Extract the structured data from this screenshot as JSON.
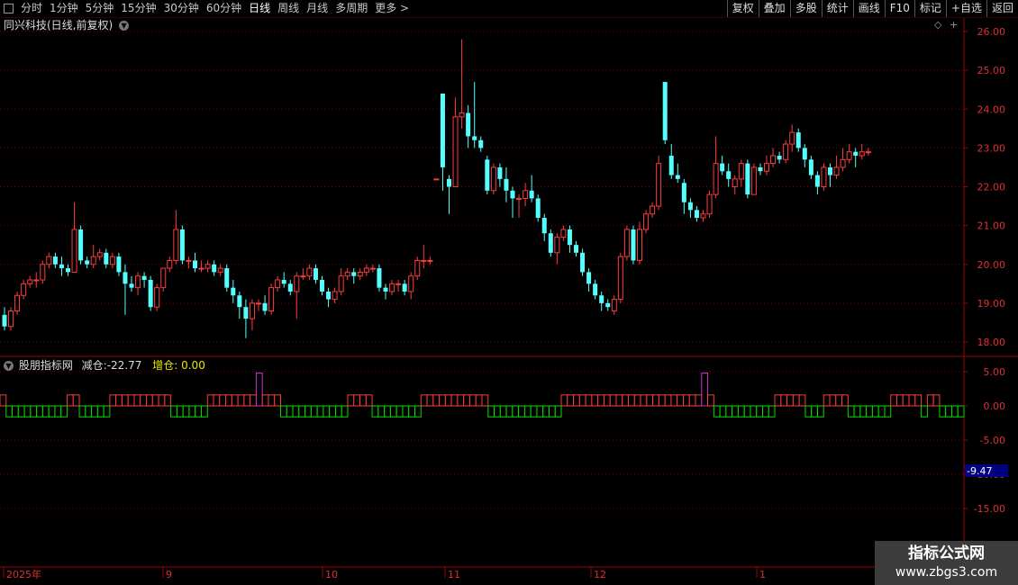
{
  "toolbar": {
    "periods": [
      "分时",
      "1分钟",
      "5分钟",
      "15分钟",
      "30分钟",
      "60分钟",
      "日线",
      "周线",
      "月线",
      "多周期",
      "更多 >"
    ],
    "active_period": "日线",
    "buttons": [
      "复权",
      "叠加",
      "多股",
      "统计",
      "画线",
      "F10",
      "标记",
      "+自选",
      "返回"
    ]
  },
  "panel": {
    "title": "同兴科技(日线,前复权)",
    "price_axis": [
      "26.00",
      "25.00",
      "24.00",
      "23.00",
      "22.00",
      "21.00",
      "20.00",
      "19.00",
      "18.00"
    ]
  },
  "indicator": {
    "name": "股朋指标网",
    "reduce_label": "减仓:",
    "reduce_value": "-22.77",
    "add_label": "增仓:",
    "add_value": "0.00",
    "axis": [
      "5.00",
      "0.00",
      "-5.00",
      "-10.00",
      "-15.00"
    ],
    "current_value": "-9.47"
  },
  "date_axis": [
    "2025年",
    "9",
    "10",
    "11",
    "12",
    "1"
  ],
  "watermark": {
    "line1": "指标公式网",
    "line2": "www.zbgs3.com"
  },
  "colors": {
    "up": "#ff3c3c",
    "down": "#54ffff",
    "bg": "#000000",
    "grid": "#7a0000",
    "neg": "#00e000",
    "special": "#cc33cc"
  },
  "chart_data": {
    "type": "candlestick",
    "ylim": [
      17.8,
      26.2
    ],
    "candles": [
      [
        18.7,
        18.4,
        18.9,
        18.3
      ],
      [
        18.4,
        18.8,
        18.9,
        18.3
      ],
      [
        18.8,
        19.2,
        19.3,
        18.7
      ],
      [
        19.2,
        19.5,
        19.6,
        19.1
      ],
      [
        19.5,
        19.6,
        19.7,
        19.4
      ],
      [
        19.6,
        19.6,
        19.8,
        19.4
      ],
      [
        19.6,
        20.0,
        20.1,
        19.5
      ],
      [
        20.0,
        20.2,
        20.3,
        19.9
      ],
      [
        20.2,
        20.0,
        20.3,
        19.9
      ],
      [
        20.0,
        19.9,
        20.2,
        19.7
      ],
      [
        19.9,
        19.8,
        20.0,
        19.7
      ],
      [
        19.8,
        20.9,
        21.6,
        19.8
      ],
      [
        20.9,
        20.1,
        21.0,
        20.0
      ],
      [
        20.1,
        20.0,
        20.2,
        19.9
      ],
      [
        20.0,
        20.2,
        20.5,
        19.9
      ],
      [
        20.2,
        20.3,
        20.4,
        20.1
      ],
      [
        20.3,
        20.0,
        20.4,
        19.9
      ],
      [
        20.0,
        20.2,
        20.3,
        19.9
      ],
      [
        20.2,
        19.8,
        20.3,
        19.7
      ],
      [
        19.8,
        19.5,
        20.0,
        18.7
      ],
      [
        19.5,
        19.4,
        19.7,
        19.3
      ],
      [
        19.4,
        19.7,
        19.8,
        19.2
      ],
      [
        19.7,
        19.6,
        19.8,
        19.4
      ],
      [
        19.6,
        18.9,
        19.7,
        18.8
      ],
      [
        18.9,
        19.4,
        19.5,
        18.8
      ],
      [
        19.4,
        19.9,
        19.9,
        19.3
      ],
      [
        19.9,
        20.1,
        20.2,
        19.8
      ],
      [
        20.1,
        20.9,
        21.4,
        20.0
      ],
      [
        20.9,
        20.1,
        21.0,
        20.0
      ],
      [
        20.1,
        20.1,
        20.2,
        19.9
      ],
      [
        20.1,
        19.9,
        20.3,
        19.8
      ],
      [
        19.9,
        19.9,
        20.1,
        19.8
      ],
      [
        19.9,
        20.0,
        20.1,
        19.8
      ],
      [
        20.0,
        19.8,
        20.1,
        19.7
      ],
      [
        19.8,
        19.9,
        20.0,
        19.7
      ],
      [
        19.9,
        19.4,
        20.0,
        19.3
      ],
      [
        19.4,
        19.2,
        19.6,
        19.0
      ],
      [
        19.2,
        18.9,
        19.3,
        18.6
      ],
      [
        18.9,
        18.6,
        19.1,
        18.1
      ],
      [
        18.6,
        19.0,
        19.1,
        18.3
      ],
      [
        19.0,
        19.0,
        19.1,
        18.8
      ],
      [
        19.0,
        18.8,
        19.2,
        18.7
      ],
      [
        18.8,
        19.4,
        19.5,
        18.7
      ],
      [
        19.4,
        19.6,
        19.7,
        19.3
      ],
      [
        19.6,
        19.5,
        19.8,
        19.4
      ],
      [
        19.5,
        19.3,
        19.6,
        19.2
      ],
      [
        19.3,
        19.7,
        19.8,
        18.6
      ],
      [
        19.7,
        19.7,
        19.9,
        19.6
      ],
      [
        19.7,
        19.9,
        20.0,
        19.6
      ],
      [
        19.9,
        19.6,
        20.0,
        19.5
      ],
      [
        19.6,
        19.3,
        19.7,
        19.2
      ],
      [
        19.3,
        19.1,
        19.4,
        18.9
      ],
      [
        19.1,
        19.3,
        19.4,
        19.0
      ],
      [
        19.3,
        19.7,
        19.9,
        19.2
      ],
      [
        19.7,
        19.8,
        19.9,
        19.6
      ],
      [
        19.8,
        19.7,
        19.9,
        19.5
      ],
      [
        19.7,
        19.8,
        19.9,
        19.6
      ],
      [
        19.8,
        19.9,
        20.0,
        19.7
      ],
      [
        19.9,
        19.9,
        20.0,
        19.8
      ],
      [
        19.9,
        19.4,
        20.0,
        19.3
      ],
      [
        19.4,
        19.3,
        19.5,
        19.1
      ],
      [
        19.3,
        19.5,
        19.6,
        19.2
      ],
      [
        19.5,
        19.5,
        19.6,
        19.3
      ],
      [
        19.5,
        19.3,
        19.6,
        19.2
      ],
      [
        19.3,
        19.7,
        19.8,
        19.1
      ],
      [
        19.7,
        20.1,
        20.2,
        19.6
      ],
      [
        20.1,
        20.1,
        20.5,
        19.9
      ],
      [
        20.1,
        20.1,
        20.2,
        20.0
      ],
      [
        22.2,
        22.2,
        22.2,
        22.2
      ],
      [
        24.4,
        22.5,
        24.4,
        21.9
      ],
      [
        22.2,
        22.0,
        22.3,
        21.3
      ],
      [
        22.0,
        23.8,
        24.3,
        22.0
      ],
      [
        23.8,
        23.9,
        25.8,
        23.5
      ],
      [
        23.9,
        23.3,
        24.1,
        23.0
      ],
      [
        23.3,
        23.2,
        24.7,
        23.0
      ],
      [
        23.2,
        23.0,
        23.3,
        22.9
      ],
      [
        22.7,
        21.9,
        22.8,
        21.8
      ],
      [
        21.9,
        22.5,
        22.6,
        21.8
      ],
      [
        22.5,
        22.2,
        22.6,
        22.0
      ],
      [
        22.2,
        21.9,
        22.5,
        21.6
      ],
      [
        21.9,
        21.7,
        22.0,
        21.2
      ],
      [
        21.7,
        21.7,
        21.8,
        21.2
      ],
      [
        21.7,
        21.9,
        22.1,
        21.5
      ],
      [
        21.9,
        21.7,
        22.3,
        21.6
      ],
      [
        21.7,
        21.2,
        21.8,
        21.1
      ],
      [
        21.2,
        20.8,
        21.3,
        20.6
      ],
      [
        20.8,
        20.3,
        20.9,
        20.2
      ],
      [
        20.3,
        20.7,
        20.8,
        20.0
      ],
      [
        20.7,
        20.9,
        21.0,
        20.6
      ],
      [
        20.9,
        20.5,
        21.0,
        20.3
      ],
      [
        20.5,
        20.3,
        20.6,
        20.2
      ],
      [
        20.3,
        19.8,
        20.4,
        19.7
      ],
      [
        19.8,
        19.5,
        19.9,
        19.3
      ],
      [
        19.5,
        19.2,
        19.6,
        19.1
      ],
      [
        19.2,
        19.0,
        19.3,
        18.8
      ],
      [
        19.0,
        18.9,
        19.1,
        18.8
      ],
      [
        18.8,
        19.1,
        19.2,
        18.7
      ],
      [
        19.1,
        20.2,
        20.3,
        19.0
      ],
      [
        20.2,
        20.9,
        21.0,
        20.1
      ],
      [
        20.9,
        20.1,
        21.0,
        20.0
      ],
      [
        20.1,
        20.9,
        21.1,
        20.0
      ],
      [
        20.9,
        21.3,
        21.4,
        20.8
      ],
      [
        21.3,
        21.5,
        21.6,
        21.2
      ],
      [
        21.5,
        22.6,
        22.8,
        21.4
      ],
      [
        24.7,
        23.2,
        24.7,
        23.1
      ],
      [
        22.8,
        22.3,
        23.1,
        22.2
      ],
      [
        22.3,
        22.2,
        22.6,
        22.1
      ],
      [
        22.1,
        21.6,
        22.2,
        21.3
      ],
      [
        21.6,
        21.4,
        21.7,
        21.2
      ],
      [
        21.4,
        21.2,
        21.5,
        21.1
      ],
      [
        21.2,
        21.3,
        21.4,
        21.1
      ],
      [
        21.3,
        21.8,
        21.9,
        21.2
      ],
      [
        21.8,
        22.6,
        23.3,
        21.7
      ],
      [
        22.6,
        22.4,
        22.8,
        22.3
      ],
      [
        22.4,
        22.2,
        22.6,
        22.0
      ],
      [
        22.0,
        22.2,
        22.3,
        21.8
      ],
      [
        22.2,
        22.6,
        22.7,
        22.0
      ],
      [
        22.6,
        21.8,
        22.7,
        21.7
      ],
      [
        21.8,
        22.5,
        22.6,
        21.8
      ],
      [
        22.5,
        22.4,
        22.6,
        22.3
      ],
      [
        22.4,
        22.6,
        22.8,
        22.3
      ],
      [
        22.6,
        22.8,
        23.0,
        22.5
      ],
      [
        22.8,
        22.7,
        22.9,
        22.6
      ],
      [
        22.7,
        23.1,
        23.2,
        22.6
      ],
      [
        23.1,
        23.4,
        23.6,
        22.9
      ],
      [
        23.4,
        23.0,
        23.5,
        22.9
      ],
      [
        23.0,
        22.7,
        23.1,
        22.5
      ],
      [
        22.7,
        22.3,
        22.8,
        22.2
      ],
      [
        22.3,
        22.0,
        22.4,
        21.8
      ],
      [
        22.0,
        22.5,
        22.6,
        21.9
      ],
      [
        22.5,
        22.3,
        22.6,
        22.0
      ],
      [
        22.3,
        22.5,
        22.8,
        22.2
      ],
      [
        22.5,
        22.7,
        23.0,
        22.4
      ],
      [
        22.7,
        22.9,
        23.1,
        22.6
      ],
      [
        22.9,
        22.8,
        23.0,
        22.5
      ],
      [
        22.8,
        22.9,
        23.1,
        22.7
      ],
      [
        22.9,
        22.9,
        23.0,
        22.8
      ]
    ],
    "indicator_bars": [
      1,
      -1,
      -1,
      -1,
      -1,
      -1,
      -1,
      -1,
      -1,
      -1,
      -1,
      1,
      1,
      -1,
      -1,
      -1,
      -1,
      -1,
      1,
      1,
      1,
      1,
      1,
      1,
      1,
      1,
      1,
      1,
      -1,
      -1,
      -1,
      -1,
      -1,
      -1,
      1,
      1,
      1,
      1,
      1,
      1,
      1,
      1,
      3,
      1,
      1,
      1,
      -1,
      -1,
      -1,
      -1,
      -1,
      -1,
      -1,
      -1,
      -1,
      -1,
      -1,
      1,
      1,
      1,
      1,
      -1,
      -1,
      -1,
      -1,
      -1,
      -1,
      -1,
      -1,
      1,
      1,
      1,
      1,
      1,
      1,
      1,
      1,
      1,
      1,
      1,
      -1,
      -1,
      -1,
      -1,
      -1,
      -1,
      -1,
      -1,
      -1,
      -1,
      -1,
      -1,
      1,
      1,
      1,
      1,
      1,
      1,
      1,
      1,
      1,
      1,
      1,
      1,
      1,
      1,
      1,
      1,
      1,
      1,
      1,
      1,
      1,
      1,
      1,
      3,
      1,
      -1,
      -1,
      -1,
      -1,
      -1,
      -1,
      -1,
      -1,
      -1,
      -1,
      1,
      1,
      1,
      1,
      1,
      -1,
      -1,
      -1,
      1,
      1,
      1,
      1,
      -1,
      -1,
      -1,
      -1,
      -1,
      -1,
      -1,
      1,
      1,
      1,
      1,
      1,
      -1,
      1,
      1,
      -1,
      -1,
      -1,
      -1
    ]
  }
}
